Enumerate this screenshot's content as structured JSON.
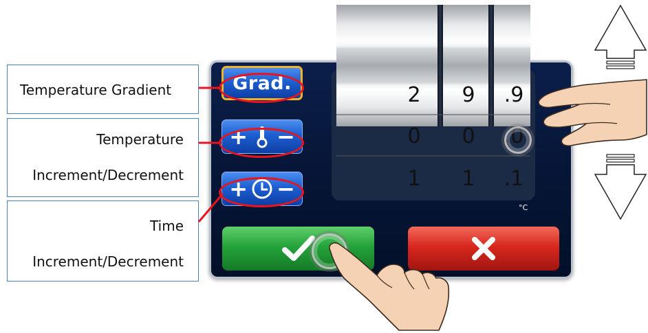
{
  "callouts": {
    "gradient": "Temperature Gradient",
    "temperature_line1": "Temperature",
    "temperature_line2": "Increment/Decrement",
    "time_line1": "Time",
    "time_line2": "Increment/Decrement"
  },
  "buttons": {
    "gradient_label": "Grad.",
    "plus": "+",
    "minus": "−",
    "confirm_icon": "checkmark-icon",
    "cancel_icon": "close-icon"
  },
  "roller": {
    "rows": [
      [
        "2",
        "9",
        ".9"
      ],
      [
        "0",
        "0",
        ".0"
      ],
      [
        "1",
        "1",
        ".1"
      ]
    ],
    "unit": "°C"
  },
  "colors": {
    "callout_line": "#e8141e",
    "selected_border": "#f0b429",
    "confirm": "#25a33a",
    "cancel": "#d8281e",
    "panel": "#061536"
  }
}
